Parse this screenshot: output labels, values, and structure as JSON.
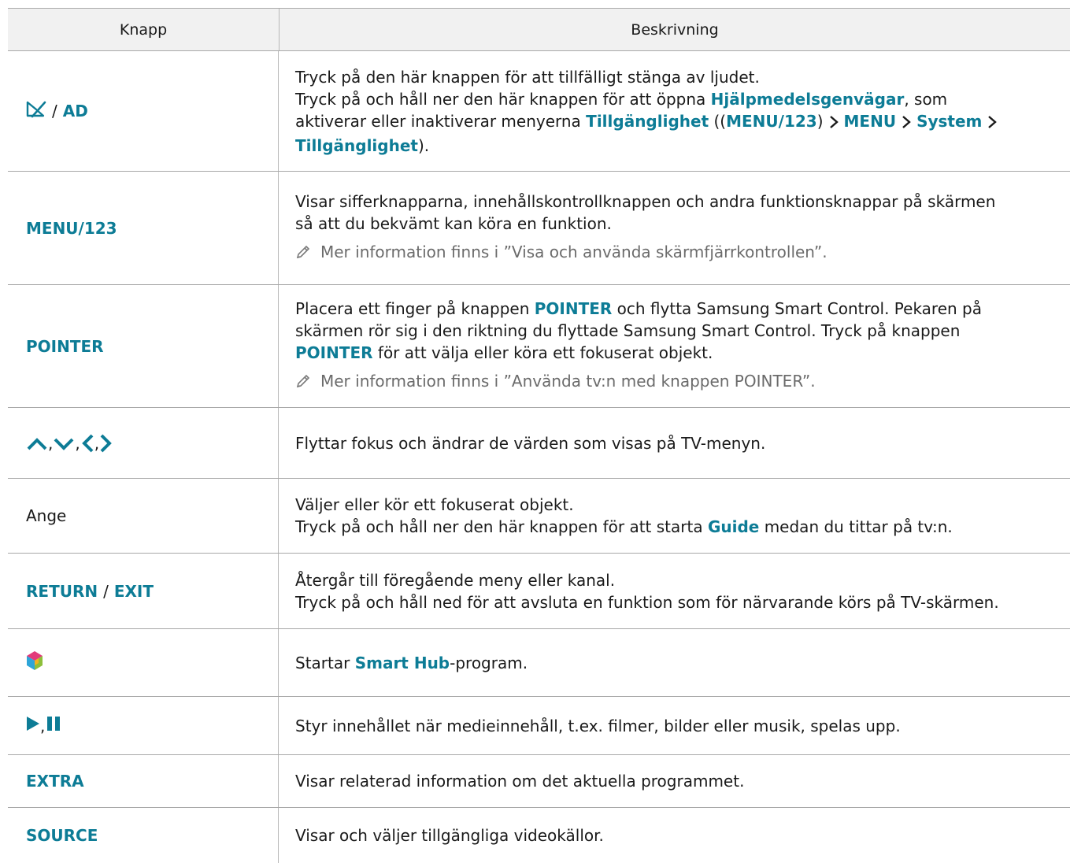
{
  "table": {
    "header": {
      "col1": "Knapp",
      "col2": "Beskrivning"
    },
    "rows": {
      "mute_ad": {
        "key_sep": "/",
        "key_ad": "AD",
        "l1": "Tryck på den här knappen för att tillfälligt stänga av ljudet.",
        "l2_a": "Tryck på och håll ner den här knappen för att öppna ",
        "l2_b": "Hjälpmedelsgenvägar",
        "l2_c": ", som",
        "l3_a": "aktiverar eller inaktiverar menyerna ",
        "l3_b": "Tillgänglighet",
        "l3_c": " ((",
        "l3_d": "MENU/123",
        "l3_e": ")",
        "l3_f": "MENU",
        "l3_g": "System",
        "l4_a": "Tillgänglighet",
        "l4_b": ")."
      },
      "menu123": {
        "key": "MENU/123",
        "l1": "Visar sifferknapparna, innehållskontrollknappen och andra funktionsknappar på skärmen",
        "l2": "så att du bekvämt kan köra en funktion.",
        "note": "Mer information finns i ”Visa och använda skärmfjärrkontrollen”."
      },
      "pointer": {
        "key": "POINTER",
        "l1_a": "Placera ett finger på knappen ",
        "l1_b": "POINTER",
        "l1_c": " och flytta Samsung Smart Control. Pekaren på",
        "l2": "skärmen rör sig i den riktning du flyttade Samsung Smart Control. Tryck på knappen",
        "l3_a": "POINTER",
        "l3_b": " för att välja eller köra ett fokuserat objekt.",
        "note": "Mer information finns i ”Använda tv:n med knappen POINTER”."
      },
      "arrows": {
        "comma": ",",
        "text": "Flyttar fokus och ändrar de värden som visas på TV-menyn."
      },
      "ange": {
        "key": "Ange",
        "l1": "Väljer eller kör ett fokuserat objekt.",
        "l2_a": "Tryck på och håll ner den här knappen för att starta ",
        "l2_b": "Guide",
        "l2_c": " medan du tittar på tv:n."
      },
      "return_exit": {
        "key_a": "RETURN",
        "key_sep": "/",
        "key_b": "EXIT",
        "l1": "Återgår till föregående meny eller kanal.",
        "l2": "Tryck på och håll ned för att avsluta en funktion som för närvarande körs på TV-skärmen."
      },
      "smarthub": {
        "l1_a": "Startar ",
        "l1_b": "Smart Hub",
        "l1_c": "-program."
      },
      "play_pause": {
        "comma": ",",
        "text": "Styr innehållet när medieinnehåll, t.ex. filmer, bilder eller musik, spelas upp."
      },
      "extra": {
        "key": "EXTRA",
        "text": "Visar relaterad information om det aktuella programmet."
      },
      "source": {
        "key": "SOURCE",
        "text": "Visar och väljer tillgängliga videokällor."
      }
    }
  },
  "icons": {
    "mute": "mute-icon",
    "arrows": [
      "up-arrow-icon",
      "down-arrow-icon",
      "left-arrow-icon",
      "right-arrow-icon"
    ],
    "smarthub": "smart-hub-icon",
    "play": "play-icon",
    "pause": "pause-icon",
    "note": "pencil-icon",
    "chevron": "chevron-right-icon"
  },
  "colors": {
    "highlight": "#0d7c96",
    "header_bg": "#f1f1f1",
    "note": "#6b6b6b"
  }
}
